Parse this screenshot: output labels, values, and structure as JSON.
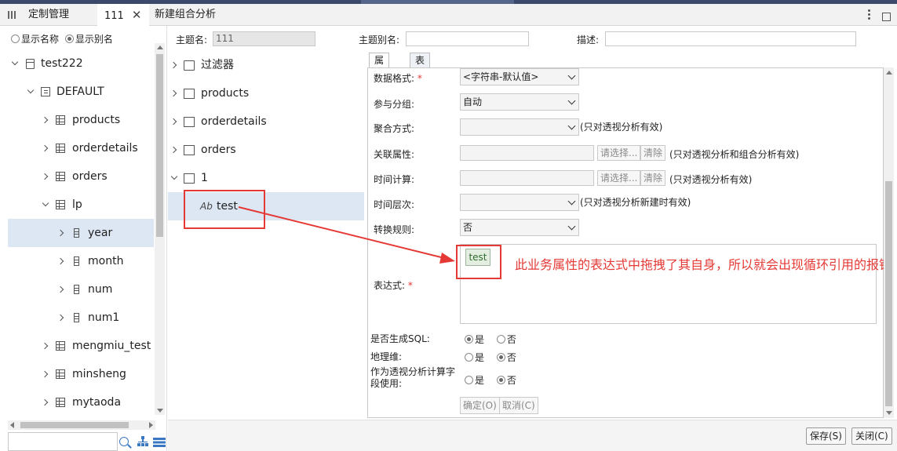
{
  "tabs": {
    "menu_label": "定制管理",
    "tab1_label": "111",
    "tab2_label": "新建组合分析"
  },
  "left_panel": {
    "radio_name": "显示名称",
    "radio_alias": "显示别名",
    "tree": {
      "root": "test222",
      "schema": "DEFAULT",
      "items": [
        "products",
        "orderdetails",
        "orders",
        "lp",
        "year",
        "month",
        "num",
        "num1",
        "mengmiu_test",
        "minsheng",
        "mytaoda"
      ]
    }
  },
  "middle_panel": {
    "items": [
      "过滤器",
      "products",
      "orderdetails",
      "orders",
      "1",
      "test"
    ]
  },
  "header_fields": {
    "topic_name_label": "主题名:",
    "topic_name_value": "111",
    "topic_alias_label": "主题别名:",
    "desc_label": "描述:"
  },
  "prop_tabs": {
    "attr": "属性区",
    "relation": "表关系视图"
  },
  "props": {
    "data_format_label": "数据格式:",
    "data_format_value": "<字符串-默认值>",
    "group_label": "参与分组:",
    "group_value": "自动",
    "agg_label": "聚合方式:",
    "agg_hint": "(只对透视分析有效)",
    "rel_label": "关联属性:",
    "rel_select": "请选择...",
    "rel_clear": "清除",
    "rel_hint": "(只对透视分析和组合分析有效)",
    "time_calc_label": "时间计算:",
    "time_calc_select": "请选择...",
    "time_calc_clear": "清除",
    "time_calc_hint": "(只对透视分析有效)",
    "time_level_label": "时间层次:",
    "time_level_hint": "(只对透视分析新建时有效)",
    "convert_label": "转换规则:",
    "convert_value": "否",
    "expr_label": "表达式:",
    "expr_chip": "test",
    "annotation": "此业务属性的表达式中拖拽了其自身，所以就会出现循环引用的报错",
    "gen_sql_label": "是否生成SQL:",
    "geo_label": "地理维:",
    "calc_field_label": "作为透视分析计算字段使用:",
    "yes": "是",
    "no": "否",
    "ok_btn": "确定(O)",
    "cancel_btn": "取消(C)"
  },
  "footer": {
    "save_btn": "保存(S)",
    "close_btn": "关闭(C)"
  },
  "required_mark": "*"
}
